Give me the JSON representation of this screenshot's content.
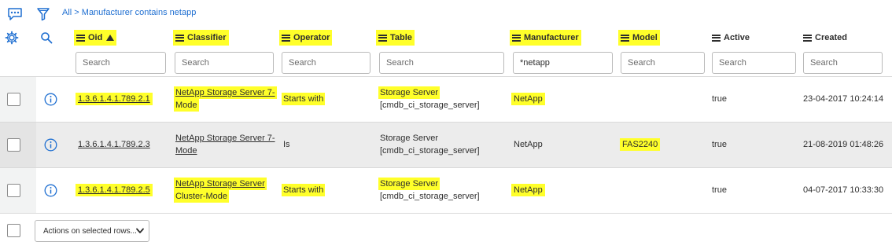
{
  "toolbar": {
    "icons": [
      "list-actions-icon",
      "filter-icon",
      "personalize-gear-icon",
      "search-icon"
    ]
  },
  "breadcrumb": {
    "all": "All",
    "separator": " > ",
    "condition": "Manufacturer contains netapp"
  },
  "columns": [
    {
      "key": "oid",
      "label": "Oid",
      "sorted": "ascending",
      "highlighted": true
    },
    {
      "key": "classifier",
      "label": "Classifier",
      "highlighted": true
    },
    {
      "key": "operator",
      "label": "Operator",
      "highlighted": true
    },
    {
      "key": "table",
      "label": "Table",
      "highlighted": true
    },
    {
      "key": "manufacturer",
      "label": "Manufacturer",
      "highlighted": true
    },
    {
      "key": "model",
      "label": "Model",
      "highlighted": true
    },
    {
      "key": "active",
      "label": "Active",
      "highlighted": false
    },
    {
      "key": "created",
      "label": "Created",
      "highlighted": false
    }
  ],
  "search": {
    "oid": {
      "placeholder": "Search",
      "value": ""
    },
    "classifier": {
      "placeholder": "Search",
      "value": ""
    },
    "operator": {
      "placeholder": "Search",
      "value": ""
    },
    "table": {
      "placeholder": "Search",
      "value": ""
    },
    "manufacturer": {
      "placeholder": "Search",
      "value": "*netapp"
    },
    "model": {
      "placeholder": "Search",
      "value": ""
    },
    "active": {
      "placeholder": "Search",
      "value": ""
    },
    "created": {
      "placeholder": "Search",
      "value": ""
    }
  },
  "rows": [
    {
      "oid": "1.3.6.1.4.1.789.2.1",
      "classifier_line1": "NetApp Storage Server 7-",
      "classifier_line2": "Mode",
      "operator": "Starts with",
      "table_line1": "Storage Server",
      "table_line2": "[cmdb_ci_storage_server]",
      "manufacturer": "NetApp",
      "model": "",
      "active": "true",
      "created": "23-04-2017 10:24:14",
      "highlighted": true
    },
    {
      "oid": "1.3.6.1.4.1.789.2.3",
      "classifier_line1": "NetApp Storage Server 7-",
      "classifier_line2": "Mode",
      "operator": "Is",
      "table_line1": "Storage Server",
      "table_line2": "[cmdb_ci_storage_server]",
      "manufacturer": "NetApp",
      "model": "FAS2240",
      "active": "true",
      "created": "21-08-2019 01:48:26",
      "highlighted": false
    },
    {
      "oid": "1.3.6.1.4.1.789.2.5",
      "classifier_line1": "NetApp Storage Server",
      "classifier_line2": "Cluster-Mode",
      "operator": "Starts with",
      "table_line1": "Storage Server",
      "table_line2": "[cmdb_ci_storage_server]",
      "manufacturer": "NetApp",
      "model": "",
      "active": "true",
      "created": "04-07-2017 10:33:30",
      "highlighted": true
    }
  ],
  "footer": {
    "actions_label": "Actions on selected rows..."
  },
  "colors": {
    "highlight": "#ffff2a",
    "link_blue": "#1f6fd1",
    "alt_row": "#ececec"
  }
}
